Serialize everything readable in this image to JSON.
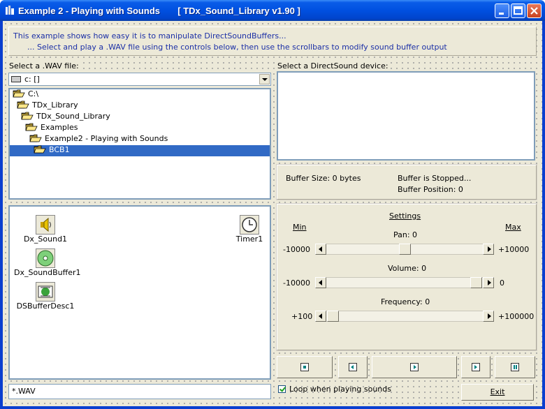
{
  "window": {
    "title": "Example 2 - Playing with Sounds       [ TDx_Sound_Library v1.90 ]"
  },
  "info": {
    "line1": "This example shows how easy it is to manipulate DirectSoundBuffers...",
    "line2": "... Select and play a .WAV file using the controls below, then use the scrollbars to modify sound buffer output"
  },
  "file_panel": {
    "label": "Select a .WAV file:",
    "drive": "c: []",
    "tree": [
      {
        "label": "C:\\",
        "indent": 0,
        "selected": false
      },
      {
        "label": "TDx_Library",
        "indent": 1,
        "selected": false
      },
      {
        "label": "TDx_Sound_Library",
        "indent": 2,
        "selected": false
      },
      {
        "label": "Examples",
        "indent": 3,
        "selected": false
      },
      {
        "label": "Example2 - Playing with Sounds",
        "indent": 4,
        "selected": false
      },
      {
        "label": "BCB1",
        "indent": 5,
        "selected": true
      }
    ],
    "filter": "*.WAV"
  },
  "components": [
    {
      "label": "Dx_Sound1",
      "icon": "speaker-icon"
    },
    {
      "label": "Dx_SoundBuffer1",
      "icon": "cd-icon"
    },
    {
      "label": "DSBufferDesc1",
      "icon": "buffer-desc-icon"
    },
    {
      "label": "Timer1",
      "icon": "clock-icon"
    }
  ],
  "device_panel": {
    "label": "Select a DirectSound device:"
  },
  "buffer": {
    "size": "Buffer Size: 0 bytes",
    "state": "Buffer is Stopped...",
    "position": "Buffer Position: 0"
  },
  "settings": {
    "title": "Settings",
    "min": "Min",
    "max": "Max",
    "pan": {
      "label": "Pan: 0",
      "min": "-10000",
      "max": "+10000",
      "level": 0.5
    },
    "volume": {
      "label": "Volume: 0",
      "min": "-10000",
      "max": "0",
      "level": 1.0
    },
    "frequency": {
      "label": "Frequency: 0",
      "min": "+100",
      "max": "+100000",
      "level": 0.0
    }
  },
  "controls": {
    "loop_label": "Loop when playing sounds",
    "loop_checked": true,
    "exit_label": "Exit"
  }
}
